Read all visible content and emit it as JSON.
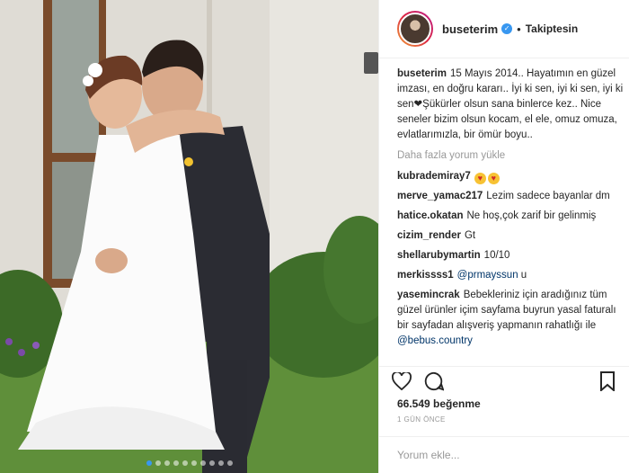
{
  "post": {
    "username": "buseterim",
    "follow_state": "Takiptesin",
    "separator": "•",
    "caption": "15 Mayıs 2014.. Hayatımın en güzel imzası, en doğru kararı.. İyi ki sen, iyi ki sen, iyi ki sen❤Şükürler olsun sana binlerce kez.. Nice seneler bizim olsun kocam, el ele, omuz omuza, evlatlarımızla, bir ömür boyu..",
    "load_more": "Daha fazla yorum yükle",
    "likes": "66.549 beğenme",
    "timestamp": "1 GÜN ÖNCE",
    "comment_placeholder": "Yorum ekle..."
  },
  "comments": [
    {
      "user": "kubrademiray7",
      "text": "",
      "emojis": 2
    },
    {
      "user": "merve_yamac217",
      "text": "Lezim sadece bayanlar dm"
    },
    {
      "user": "hatice.okatan",
      "text": "Ne hoş,çok zarif bir gelinmiş"
    },
    {
      "user": "cizim_render",
      "text": "Gt"
    },
    {
      "user": "shellarubymartin",
      "text": "10/10"
    },
    {
      "user": "merkissss1",
      "text": "@prmayssun u"
    },
    {
      "user": "yasemincrak",
      "text": "Bebekleriniz için aradığınız tüm güzel ürünler içim sayfama buyrun yasal faturalı bir sayfadan alışveriş yapmanın rahatlığı ile @bebus.country"
    }
  ],
  "icons": {
    "heart": "heart-icon",
    "comment": "comment-icon",
    "bookmark": "bookmark-icon",
    "verified": "verified-badge-icon"
  },
  "colors": {
    "accent": "#3897f0",
    "text": "#262626",
    "muted": "#999999",
    "mention": "#003569"
  },
  "carousel": {
    "count": 10,
    "active_index": 0
  }
}
